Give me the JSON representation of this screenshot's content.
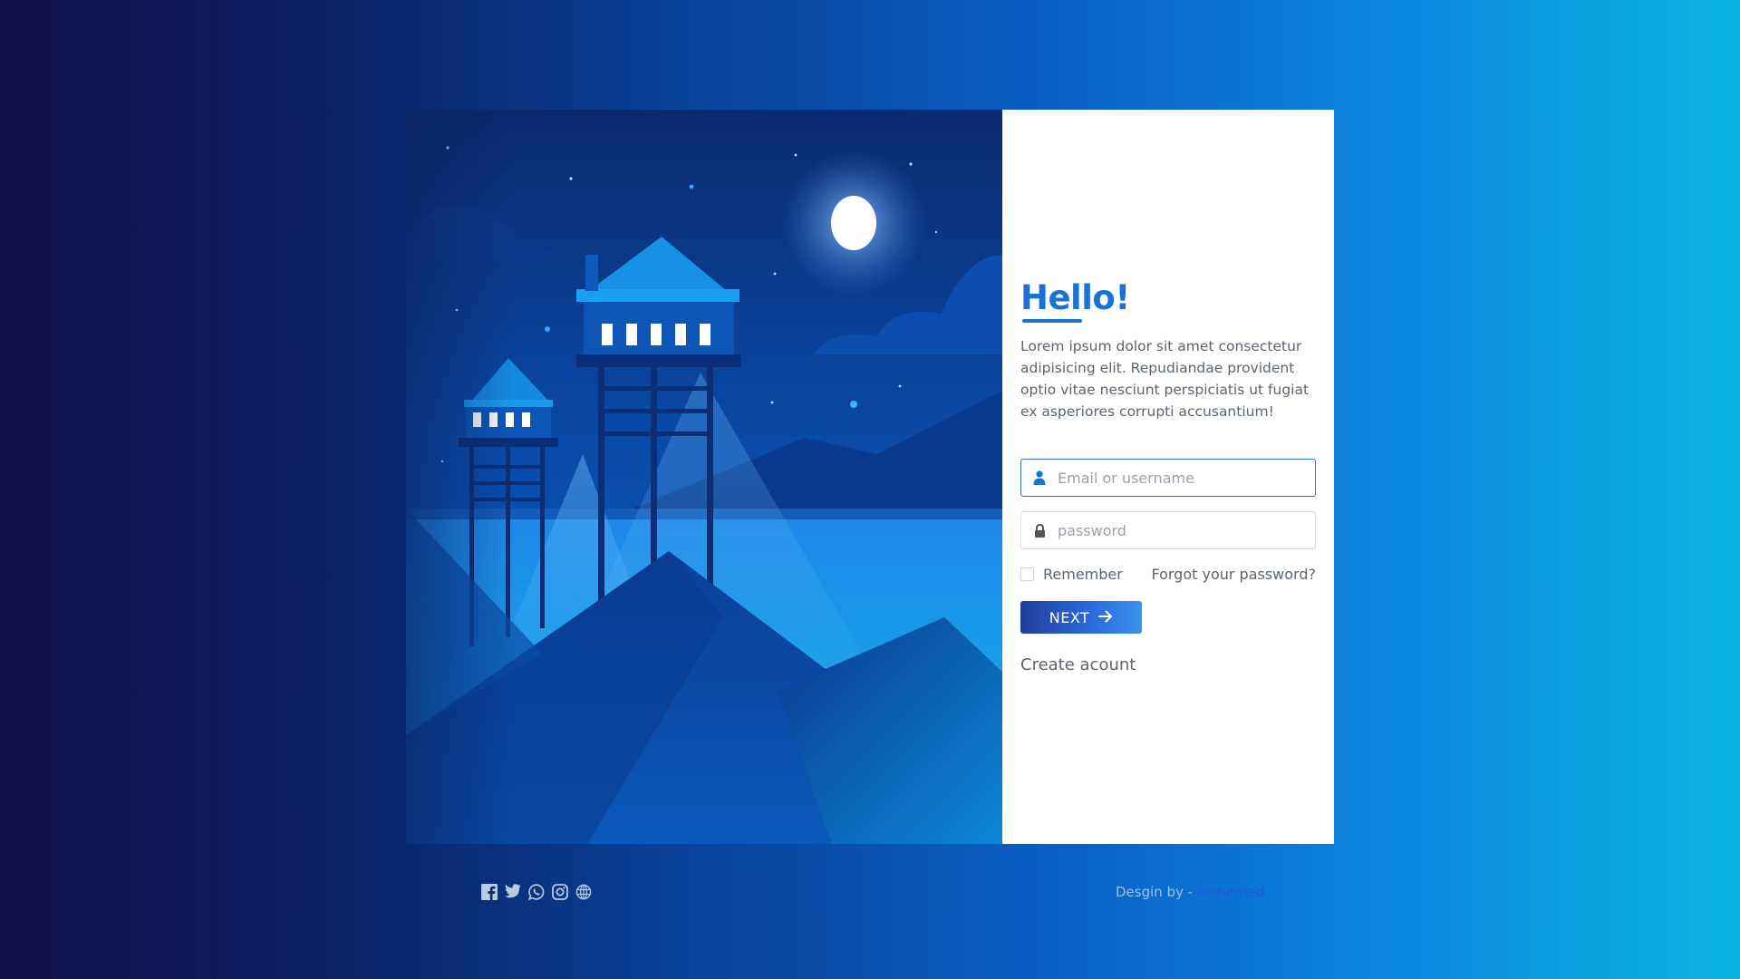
{
  "card": {
    "title": "Hello!",
    "description": "Lorem ipsum dolor sit amet consectetur adipisicing elit. Repudiandae provident optio vitae nesciunt perspiciatis ut fugiat ex asperiores corrupti accusantium!",
    "username": {
      "placeholder": "Email or username",
      "value": ""
    },
    "password": {
      "placeholder": "password",
      "value": ""
    },
    "remember_label": "Remember",
    "forgot_label": "Forgot your password?",
    "next_label": "NEXT",
    "create_label": "Create acount"
  },
  "footer": {
    "credit_prefix": "Desgin by - ",
    "credit_author": "Mohamed",
    "social_icons": [
      "facebook-icon",
      "twitter-icon",
      "whatsapp-icon",
      "instagram-icon",
      "globe-icon"
    ]
  },
  "colors": {
    "accent": "#1a73d4",
    "button_start": "#1f3f9c",
    "button_end": "#3b93f0",
    "author_link": "#1f5bd6"
  }
}
